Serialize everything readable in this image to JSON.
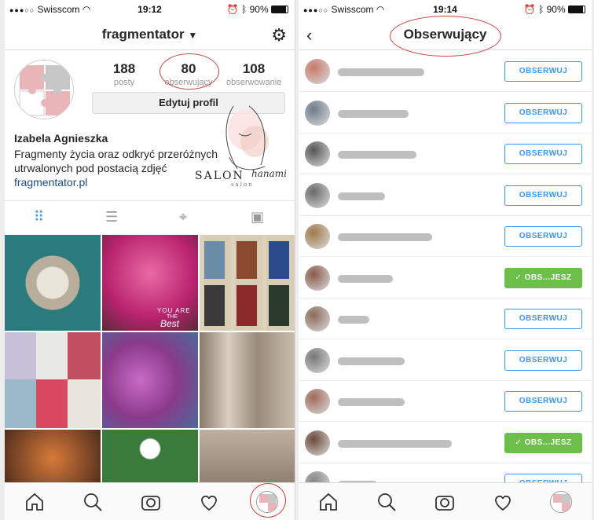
{
  "left": {
    "status": {
      "carrier": "Swisscom",
      "time": "19:12",
      "battery": "90%"
    },
    "header": {
      "username": "fragmentator"
    },
    "stats": [
      {
        "number": "188",
        "label": "posty"
      },
      {
        "number": "80",
        "label": "obserwujący"
      },
      {
        "number": "108",
        "label": "obserwowanie"
      }
    ],
    "edit_button": "Edytuj profil",
    "profile": {
      "name": "Izabela Agnieszka",
      "bio_line1": "Fragmenty życia oraz odkryć przeróżnych",
      "bio_line2": "utrwalonych pod postacią zdjęć",
      "link": "fragmentator.pl"
    },
    "watermark": {
      "word1": "SALON",
      "word2": "hanami",
      "word3": "salon"
    },
    "grid_overlay": {
      "line1": "YOU ARE",
      "line2": "THE",
      "line3": "Best"
    }
  },
  "right": {
    "status": {
      "carrier": "Swisscom",
      "time": "19:14",
      "battery": "90%"
    },
    "header": {
      "title": "Obserwujący"
    },
    "rows": [
      {
        "button": "OBSERWUJ",
        "state": "follow",
        "color": "#c87a6a"
      },
      {
        "button": "OBSERWUJ",
        "state": "follow",
        "color": "#6e7c8c"
      },
      {
        "button": "OBSERWUJ",
        "state": "follow",
        "color": "#555"
      },
      {
        "button": "OBSERWUJ",
        "state": "follow",
        "color": "#6a6a6a"
      },
      {
        "button": "OBSERWUJ",
        "state": "follow",
        "color": "#a07a4a"
      },
      {
        "button": "OBS...JESZ",
        "state": "following",
        "color": "#8a5a4a"
      },
      {
        "button": "OBSERWUJ",
        "state": "follow",
        "color": "#8a6a5a"
      },
      {
        "button": "OBSERWUJ",
        "state": "follow",
        "color": "#777"
      },
      {
        "button": "OBSERWUJ",
        "state": "follow",
        "color": "#a06a5a"
      },
      {
        "button": "OBS...JESZ",
        "state": "following",
        "color": "#6a4a3a"
      },
      {
        "button": "OBSERWUJ",
        "state": "follow",
        "color": "#888"
      }
    ]
  },
  "colors": {
    "accent": "#3897f0",
    "following": "#6cc04a",
    "highlight": "#d04040",
    "link": "#1c4b84"
  }
}
